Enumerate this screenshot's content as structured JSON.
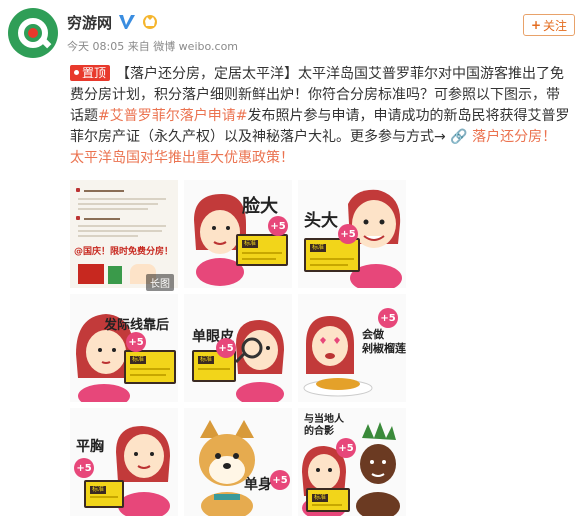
{
  "account": {
    "name": "穷游网",
    "verified_icon": "blue-v-verified-icon",
    "vip_icon": "vip-badge-icon",
    "meta": "今天 08:05 来自 微博 weibo.com"
  },
  "follow": {
    "label": "关注",
    "plus": "+"
  },
  "post": {
    "pin_label": "置顶",
    "segments": [
      {
        "type": "text",
        "text": "【落户还分房，定居太平洋】太平洋岛国艾普罗菲尔对中国游客推出了免费分房计划，积分落户细则新鲜出炉！你符合分房标准吗？可参照以下图示，带话题"
      },
      {
        "type": "link",
        "text": "#艾普罗菲尔落户申请#"
      },
      {
        "type": "text",
        "text": "发布照片参与申请，申请成功的新岛民将获得艾普罗菲尔房产证（永久产权）以及神秘落户大礼。更多参与方式→ "
      },
      {
        "type": "link",
        "text": "🔗 落户还分房！太平洋岛国对华推出重大优惠政策！"
      }
    ]
  },
  "images": {
    "long_tag": "长图",
    "doc_banner": "@国庆！限时免费分房！",
    "captions": {
      "face": "脸大",
      "head": "头大",
      "hairline": "发际线靠后",
      "eyelid": "单眼皮",
      "eat": "会做\n剁椒榴莲",
      "flat": "平胸",
      "single": "单身",
      "locals": "与当地人\n的合影"
    },
    "sign_label": "标准",
    "plus_label": "+5",
    "colors": {
      "sign_yellow": "#f2d51a",
      "plus_pink": "#e7477a",
      "hair_red": "#c23a3a",
      "skin": "#fde3c8"
    }
  },
  "colors": {
    "brand_green": "#2f9e57",
    "pin_red": "#e8392c",
    "link": "#eb7350",
    "follow_orange": "#e36c1f"
  }
}
